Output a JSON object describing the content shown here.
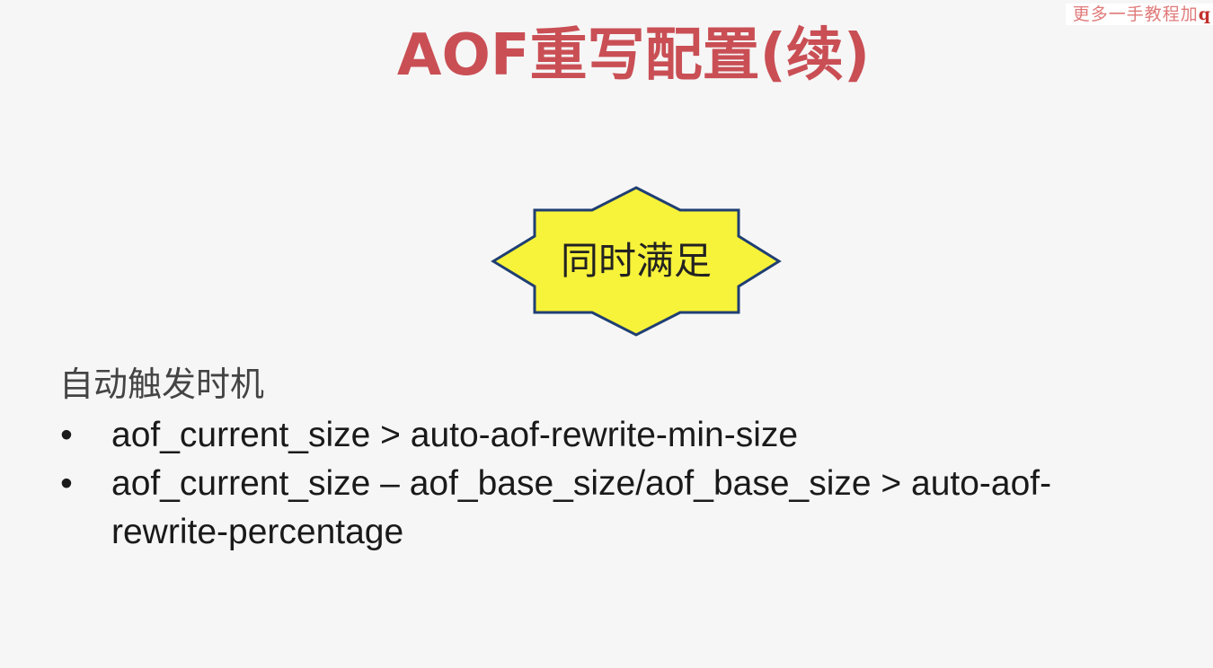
{
  "watermark": {
    "text": "更多一手教程加",
    "tail": "q"
  },
  "slide": {
    "title": "AOF重写配置(续)",
    "callout": {
      "label": "同时满足",
      "fill_color": "#f7f23a",
      "stroke_color": "#1f3f73"
    },
    "subheading": "自动触发时机",
    "bullets": [
      {
        "marker": "•",
        "text": "aof_current_size > auto-aof-rewrite-min-size"
      },
      {
        "marker": "•",
        "text": "aof_current_size – aof_base_size/aof_base_size > auto-aof-rewrite-percentage"
      }
    ],
    "title_color": "#c94f55"
  }
}
